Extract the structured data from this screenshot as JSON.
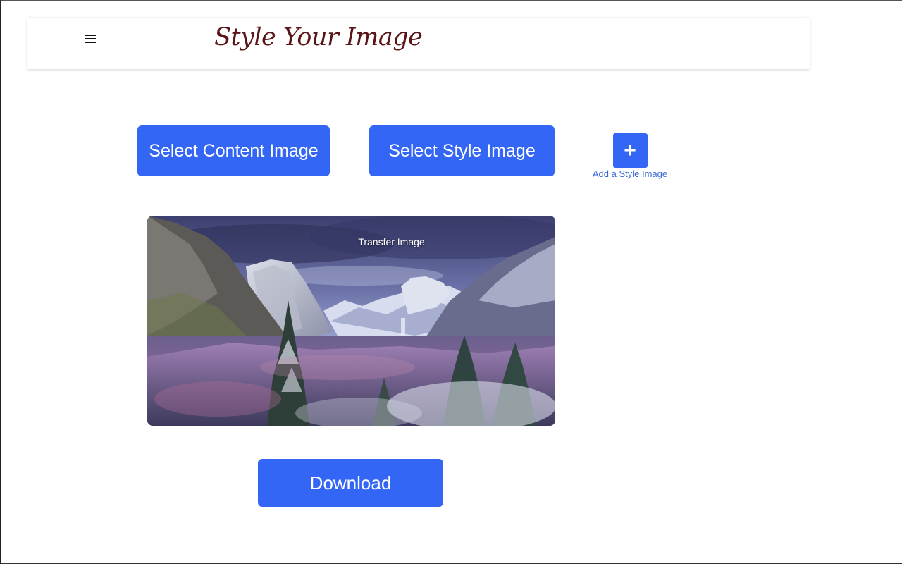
{
  "header": {
    "menu_icon": "hamburger-menu-icon",
    "title": "Style Your Image"
  },
  "actions": {
    "select_content_label": "Select Content Image",
    "select_style_label": "Select Style Image",
    "add_style_icon": "plus-icon",
    "add_style_glyph": "+",
    "add_style_label": "Add a Style Image",
    "download_label": "Download"
  },
  "result": {
    "overlay_label": "Transfer Image",
    "image_subject": "snowy mountain valley with pine forest"
  },
  "colors": {
    "accent": "#3366f4",
    "title": "#5a1518",
    "link": "#3a66d9"
  }
}
